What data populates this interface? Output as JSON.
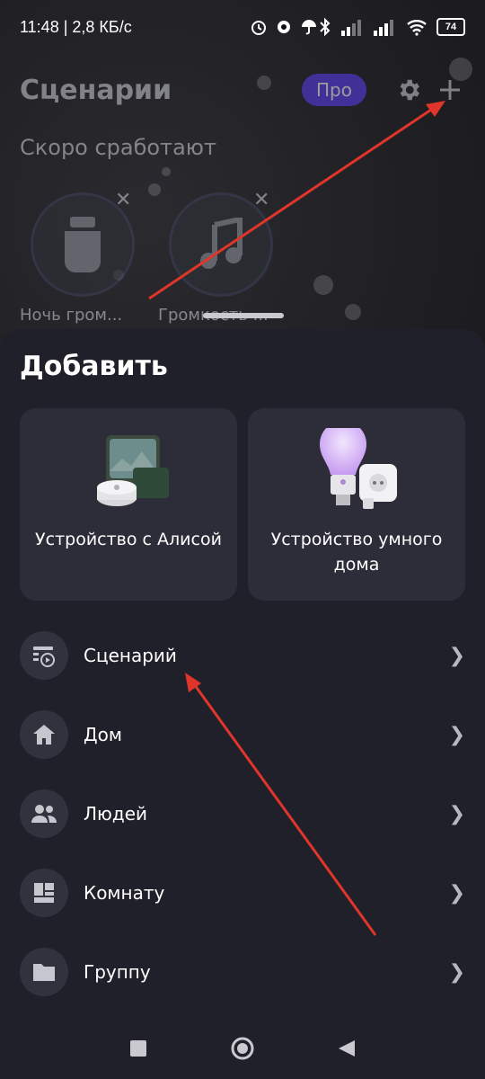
{
  "status_bar": {
    "left_text": "11:48 | 2,8 КБ/с",
    "battery": "74"
  },
  "header": {
    "title": "Сценарии",
    "pro_label": "Про",
    "settings_icon": "gear-icon",
    "add_icon": "plus-icon"
  },
  "soon_section": {
    "title": "Скоро сработают",
    "items": [
      {
        "label": "Ночь гром...",
        "icon": "speaker-icon"
      },
      {
        "label": "Громкость ...",
        "icon": "music-note-icon"
      }
    ]
  },
  "sheet": {
    "title": "Добавить",
    "tiles": [
      {
        "label": "Устройство с Алисой"
      },
      {
        "label": "Устройство умного дома"
      }
    ],
    "items": [
      {
        "label": "Сценарий",
        "icon": "scenario-icon"
      },
      {
        "label": "Дом",
        "icon": "home-icon"
      },
      {
        "label": "Людей",
        "icon": "people-icon"
      },
      {
        "label": "Комнату",
        "icon": "room-icon"
      },
      {
        "label": "Группу",
        "icon": "folder-icon"
      }
    ]
  },
  "colors": {
    "accent": "#5b3df5",
    "sheet_bg": "#1f2029",
    "annotation_arrow": "#e0352b"
  }
}
